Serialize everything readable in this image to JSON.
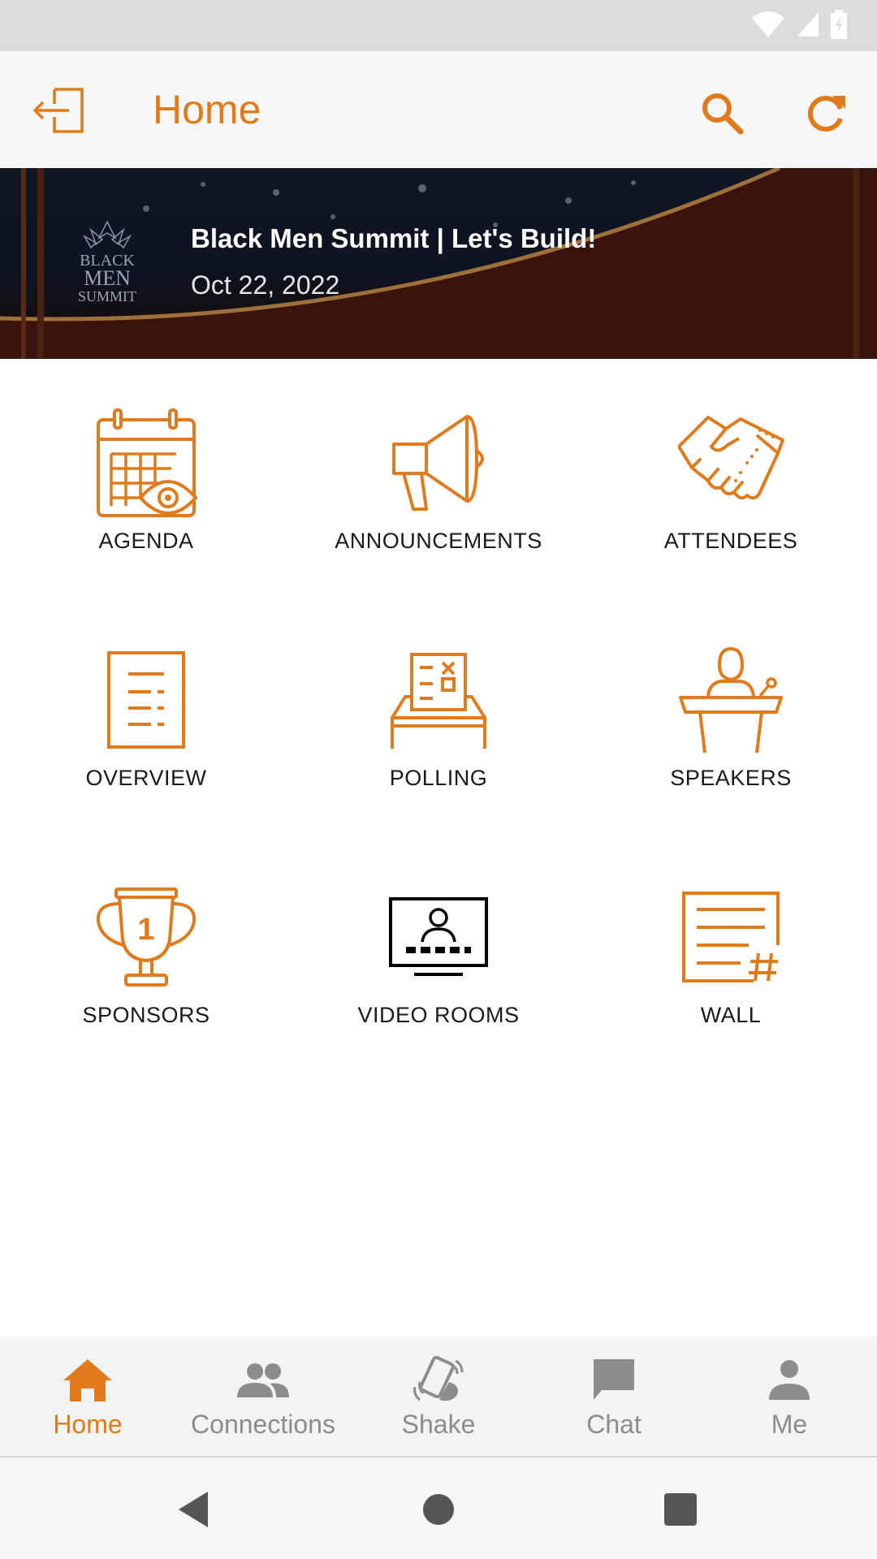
{
  "app_bar": {
    "title": "Home"
  },
  "banner": {
    "title": "Black Men Summit | Let's Build!",
    "date": "Oct 22, 2022",
    "logo_lines": [
      "BLACK",
      "MEN",
      "SUMMIT"
    ]
  },
  "grid": {
    "tiles": [
      {
        "label": "AGENDA",
        "icon": "calendar-eye-icon"
      },
      {
        "label": "ANNOUNCEMENTS",
        "icon": "megaphone-icon"
      },
      {
        "label": "ATTENDEES",
        "icon": "handshake-icon"
      },
      {
        "label": "OVERVIEW",
        "icon": "document-icon"
      },
      {
        "label": "POLLING",
        "icon": "ballot-box-icon"
      },
      {
        "label": "SPEAKERS",
        "icon": "podium-speaker-icon"
      },
      {
        "label": "SPONSORS",
        "icon": "trophy-icon"
      },
      {
        "label": "VIDEO ROOMS",
        "icon": "video-room-icon"
      },
      {
        "label": "WALL",
        "icon": "wall-hashtag-icon"
      }
    ]
  },
  "bottom_nav": {
    "items": [
      {
        "label": "Home",
        "icon": "home-icon",
        "active": true
      },
      {
        "label": "Connections",
        "icon": "people-icon",
        "active": false
      },
      {
        "label": "Shake",
        "icon": "shake-phone-icon",
        "active": false
      },
      {
        "label": "Chat",
        "icon": "chat-bubble-icon",
        "active": false
      },
      {
        "label": "Me",
        "icon": "person-icon",
        "active": false
      }
    ]
  },
  "colors": {
    "accent": "#e07a1a",
    "inactive": "#8c8c8c",
    "tile_text": "#1a1a1a"
  }
}
